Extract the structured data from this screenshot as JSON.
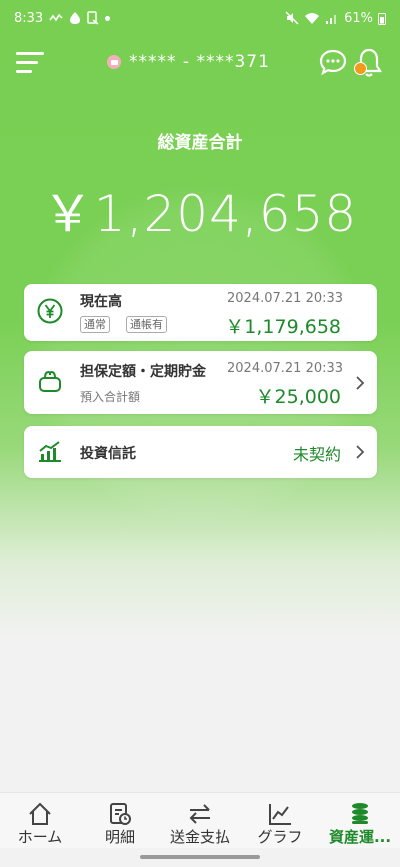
{
  "status": {
    "time": "8:33",
    "battery": "61%"
  },
  "header": {
    "account": "***** - ****371"
  },
  "summary": {
    "label": "総資産合計",
    "amount": "￥1,204,658"
  },
  "cards": [
    {
      "title": "現在高",
      "date": "2024.07.21 20:33",
      "tags": [
        "通常",
        "通帳有"
      ],
      "value": "￥1,179,658"
    },
    {
      "title": "担保定額・定期貯金",
      "date": "2024.07.21 20:33",
      "sublabel": "預入合計額",
      "value": "￥25,000"
    },
    {
      "title": "投資信託",
      "status": "未契約"
    }
  ],
  "nav": [
    {
      "label": "ホーム",
      "icon": "home-icon"
    },
    {
      "label": "明細",
      "icon": "statement-icon"
    },
    {
      "label": "送金支払",
      "icon": "transfer-icon"
    },
    {
      "label": "グラフ",
      "icon": "graph-icon"
    },
    {
      "label": "資産運...",
      "icon": "coins-icon",
      "active": true
    }
  ],
  "colors": {
    "primary": "#78cf52",
    "accent_text": "#1e8a2a",
    "badge": "#f39a1d"
  }
}
